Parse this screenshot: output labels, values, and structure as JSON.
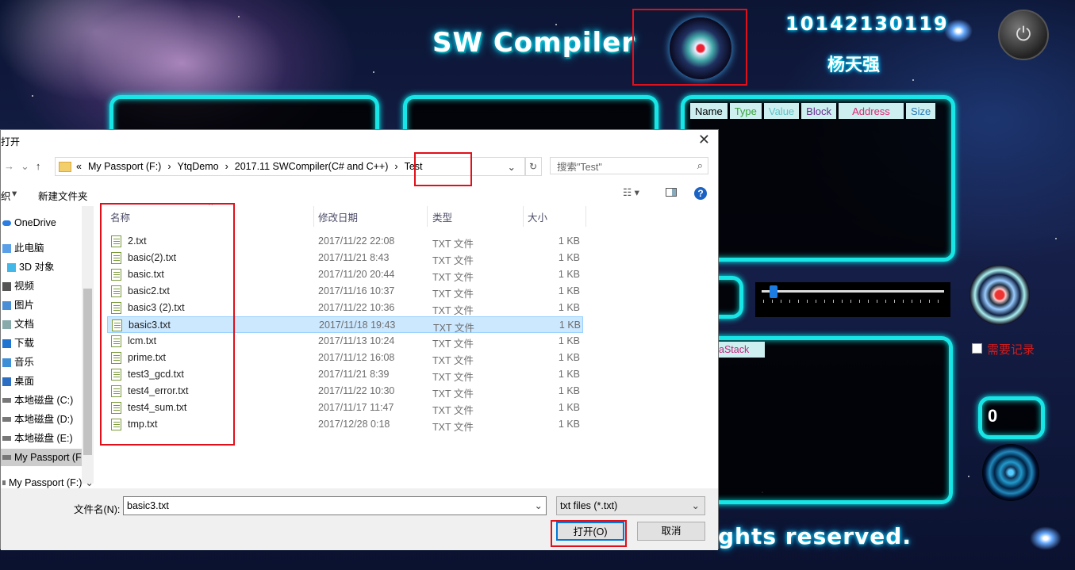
{
  "app": {
    "title": "SW Compiler",
    "student_id": "10142130119",
    "author": "杨天强",
    "footer": "ghts reserved.",
    "table_headers": [
      "Name",
      "Type",
      "Value",
      "Block",
      "Address",
      "Size"
    ],
    "table_header_colors": [
      "#000000",
      "#3aa33a",
      "#5fc3c7",
      "#6a2b8f",
      "#e0266f",
      "#2a7bb8"
    ],
    "stack_label": "aStack",
    "record_checkbox_label": "需要记录",
    "counter_value": "0"
  },
  "dialog": {
    "title": "打开",
    "close_glyph": "✕",
    "breadcrumb": [
      "«",
      "My Passport (F:)",
      "›",
      "YtqDemo",
      "›",
      "2017.11 SWCompiler(C# and C++)",
      "›",
      "Test"
    ],
    "search_placeholder": "搜索\"Test\"",
    "toolbar": {
      "organize": "织",
      "new_folder": "新建文件夹"
    },
    "sidebar": [
      {
        "label": "OneDrive",
        "icon": "cloud-icon"
      },
      {
        "label": "此电脑",
        "icon": "computer-icon"
      },
      {
        "label": "3D 对象",
        "icon": "cube-icon"
      },
      {
        "label": "视频",
        "icon": "video-icon"
      },
      {
        "label": "图片",
        "icon": "picture-icon"
      },
      {
        "label": "文档",
        "icon": "document-icon"
      },
      {
        "label": "下载",
        "icon": "download-icon"
      },
      {
        "label": "音乐",
        "icon": "music-icon"
      },
      {
        "label": "桌面",
        "icon": "desktop-icon"
      },
      {
        "label": "本地磁盘 (C:)",
        "icon": "drive-icon"
      },
      {
        "label": "本地磁盘 (D:)",
        "icon": "drive-icon"
      },
      {
        "label": "本地磁盘 (E:)",
        "icon": "drive-icon"
      },
      {
        "label": "My Passport (F",
        "icon": "drive-icon"
      },
      {
        "label": "My Passport (F:)",
        "icon": "drive-icon"
      }
    ],
    "columns": {
      "name": "名称",
      "date": "修改日期",
      "type": "类型",
      "size": "大小"
    },
    "files": [
      {
        "name": "2.txt",
        "date": "2017/11/22 22:08",
        "type": "TXT 文件",
        "size": "1 KB"
      },
      {
        "name": "basic(2).txt",
        "date": "2017/11/21 8:43",
        "type": "TXT 文件",
        "size": "1 KB"
      },
      {
        "name": "basic.txt",
        "date": "2017/11/20 20:44",
        "type": "TXT 文件",
        "size": "1 KB"
      },
      {
        "name": "basic2.txt",
        "date": "2017/11/16 10:37",
        "type": "TXT 文件",
        "size": "1 KB"
      },
      {
        "name": "basic3 (2).txt",
        "date": "2017/11/22 10:36",
        "type": "TXT 文件",
        "size": "1 KB"
      },
      {
        "name": "basic3.txt",
        "date": "2017/11/18 19:43",
        "type": "TXT 文件",
        "size": "1 KB",
        "selected": true
      },
      {
        "name": "lcm.txt",
        "date": "2017/11/13 10:24",
        "type": "TXT 文件",
        "size": "1 KB"
      },
      {
        "name": "prime.txt",
        "date": "2017/11/12 16:08",
        "type": "TXT 文件",
        "size": "1 KB"
      },
      {
        "name": "test3_gcd.txt",
        "date": "2017/11/21 8:39",
        "type": "TXT 文件",
        "size": "1 KB"
      },
      {
        "name": "test4_error.txt",
        "date": "2017/11/22 10:30",
        "type": "TXT 文件",
        "size": "1 KB"
      },
      {
        "name": "test4_sum.txt",
        "date": "2017/11/17 11:47",
        "type": "TXT 文件",
        "size": "1 KB"
      },
      {
        "name": "tmp.txt",
        "date": "2017/12/28 0:18",
        "type": "TXT 文件",
        "size": "1 KB"
      }
    ],
    "filename_label": "文件名(N):",
    "filename_value": "basic3.txt",
    "filter_value": "txt files (*.txt)",
    "open_button": "打开(O)",
    "cancel_button": "取消"
  }
}
